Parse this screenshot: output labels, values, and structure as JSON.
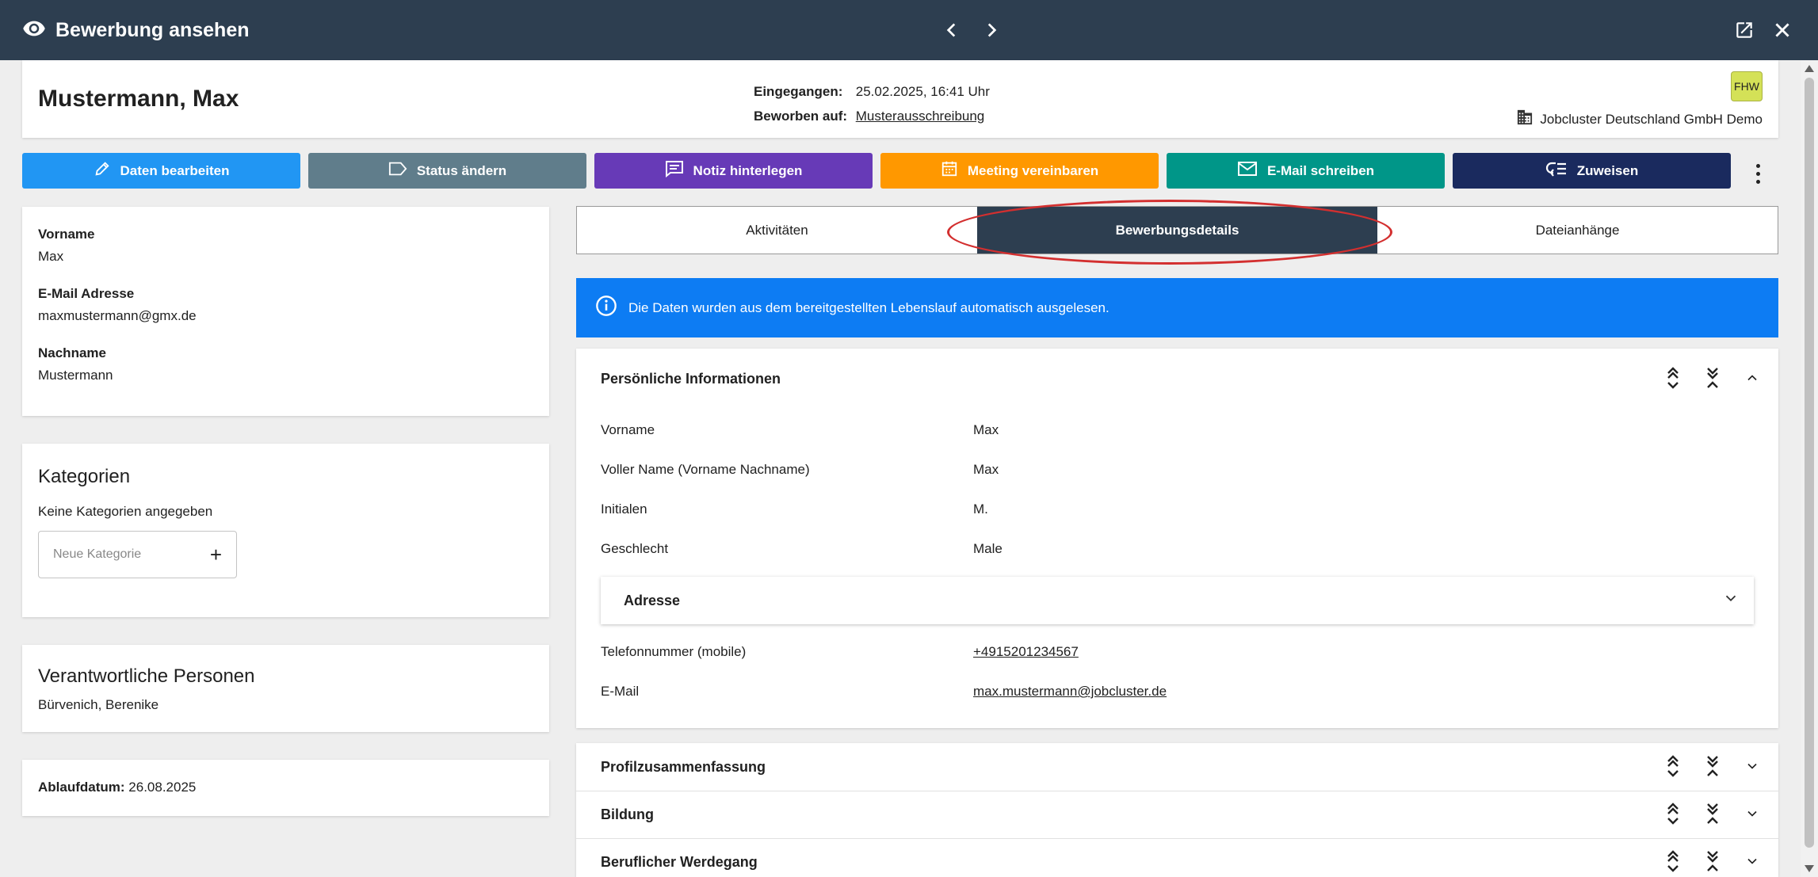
{
  "header": {
    "title": "Bewerbung ansehen",
    "icons": [
      "eye-icon",
      "chevron-left-icon",
      "chevron-right-icon",
      "open-in-new-icon",
      "close-icon"
    ]
  },
  "applicant": {
    "name": "Mustermann, Max",
    "received_label": "Eingegangen:",
    "received_value": "25.02.2025, 16:41 Uhr",
    "applied_label": "Beworben auf:",
    "applied_value": "Musterausschreibung",
    "badge": "FHW",
    "company": "Jobcluster Deutschland GmbH Demo"
  },
  "actions": [
    {
      "label": "Daten bearbeiten",
      "color": "#2196f3",
      "icon": "pencil-icon"
    },
    {
      "label": "Status ändern",
      "color": "#607d8b",
      "icon": "label-icon"
    },
    {
      "label": "Notiz hinterlegen",
      "color": "#673ab7",
      "icon": "comment-icon"
    },
    {
      "label": "Meeting vereinbaren",
      "color": "#ff9800",
      "icon": "calendar-icon"
    },
    {
      "label": "E-Mail schreiben",
      "color": "#009688",
      "icon": "mail-icon"
    },
    {
      "label": "Zuweisen",
      "color": "#1a2a5e",
      "icon": "assign-icon"
    }
  ],
  "contact": {
    "firstname_label": "Vorname",
    "firstname_value": "Max",
    "email_label": "E-Mail Adresse",
    "email_value": "maxmustermann@gmx.de",
    "lastname_label": "Nachname",
    "lastname_value": "Mustermann"
  },
  "categories": {
    "title": "Kategorien",
    "empty_text": "Keine Kategorien angegeben",
    "input_placeholder": "Neue Kategorie"
  },
  "responsible": {
    "title": "Verantwortliche Personen",
    "person": "Bürvenich, Berenike"
  },
  "expiry": {
    "label": "Ablaufdatum:",
    "value": "26.08.2025"
  },
  "tabs": [
    {
      "label": "Aktivitäten",
      "active": false
    },
    {
      "label": "Bewerbungsdetails",
      "active": true
    },
    {
      "label": "Dateianhänge",
      "active": false
    }
  ],
  "alert": {
    "text": "Die Daten wurden aus dem bereitgestellten Lebenslauf automatisch ausgelesen."
  },
  "personal": {
    "title": "Persönliche Informationen",
    "rows": [
      {
        "label": "Vorname",
        "value": "Max"
      },
      {
        "label": "Voller Name (Vorname Nachname)",
        "value": "Max"
      },
      {
        "label": "Initialen",
        "value": "M."
      },
      {
        "label": "Geschlecht",
        "value": "Male"
      }
    ],
    "address_title": "Adresse",
    "phone_label": "Telefonnummer (mobile)",
    "phone_value": "+4915201234567",
    "email_label": "E-Mail",
    "email_value": "max.mustermann@jobcluster.de"
  },
  "collapsed_sections": [
    {
      "title": "Profilzusammenfassung"
    },
    {
      "title": "Bildung"
    },
    {
      "title": "Beruflicher Werdegang"
    }
  ]
}
